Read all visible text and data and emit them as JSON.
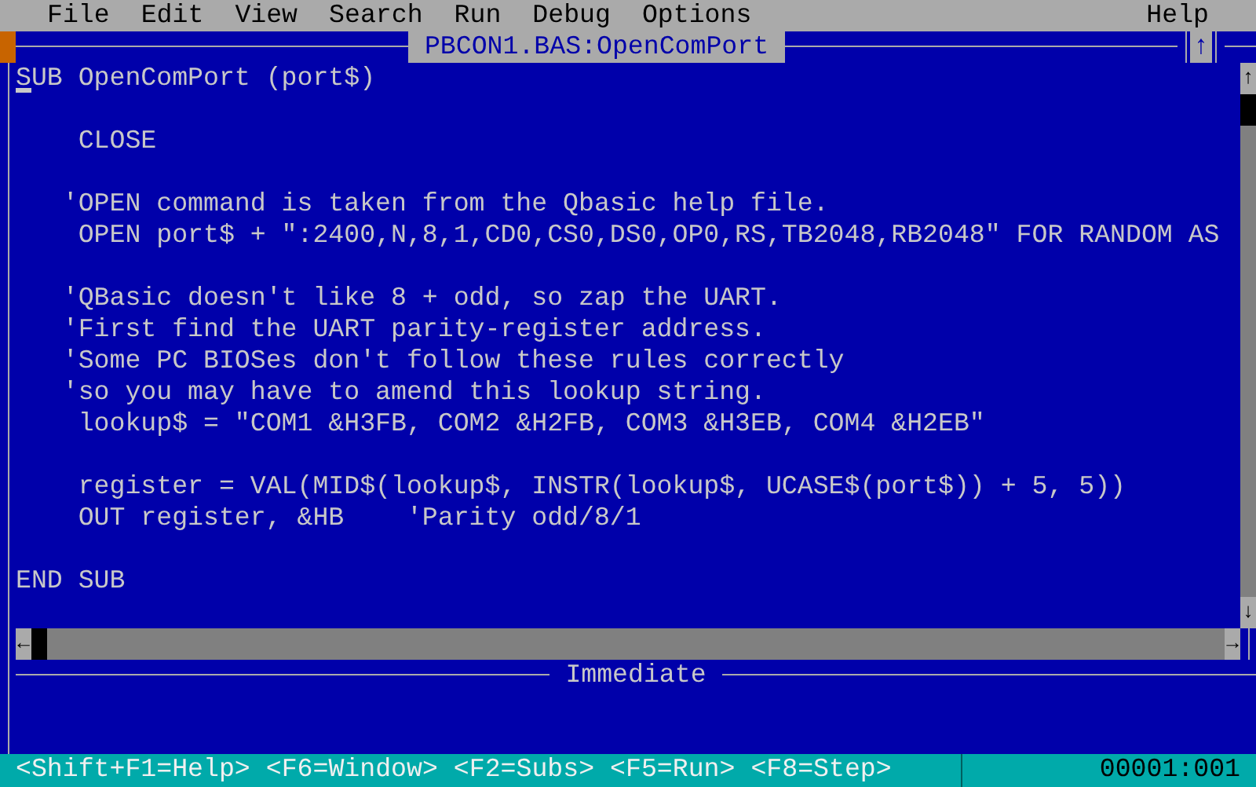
{
  "menu_left": [
    {
      "label": "File"
    },
    {
      "label": "Edit"
    },
    {
      "label": "View"
    },
    {
      "label": "Search"
    },
    {
      "label": "Run"
    },
    {
      "label": "Debug"
    },
    {
      "label": "Options"
    }
  ],
  "menu_right": [
    {
      "label": "Help"
    }
  ],
  "editor": {
    "title": "PBCON1.BAS:OpenComPort",
    "maximize_symbol": "↑",
    "blocks": [
      [
        "SUB OpenComPort (port$)"
      ],
      [
        "    CLOSE"
      ],
      [
        "   'OPEN command is taken from the Qbasic help file.",
        "    OPEN port$ + \":2400,N,8,1,CD0,CS0,DS0,OP0,RS,TB2048,RB2048\" FOR RANDOM AS"
      ],
      [
        "   'QBasic doesn't like 8 + odd, so zap the UART.",
        "   'First find the UART parity-register address.",
        "   'Some PC BIOSes don't follow these rules correctly",
        "   'so you may have to amend this lookup string.",
        "    lookup$ = \"COM1 &H3FB, COM2 &H2FB, COM3 &H3EB, COM4 &H2EB\""
      ],
      [
        "    register = VAL(MID$(lookup$, INSTR(lookup$, UCASE$(port$)) + 5, 5))",
        "    OUT register, &HB    'Parity odd/8/1"
      ],
      [
        "END SUB"
      ]
    ],
    "vscroll": {
      "up": "↑",
      "down": "↓"
    },
    "hscroll": {
      "left": "←",
      "right": "→"
    }
  },
  "immediate": {
    "title": "Immediate"
  },
  "status_bar": {
    "shortcuts": [
      "<Shift+F1=Help>",
      "<F6=Window>",
      "<F2=Subs>",
      "<F5=Run>",
      "<F8=Step>"
    ],
    "position": "00001:001"
  }
}
